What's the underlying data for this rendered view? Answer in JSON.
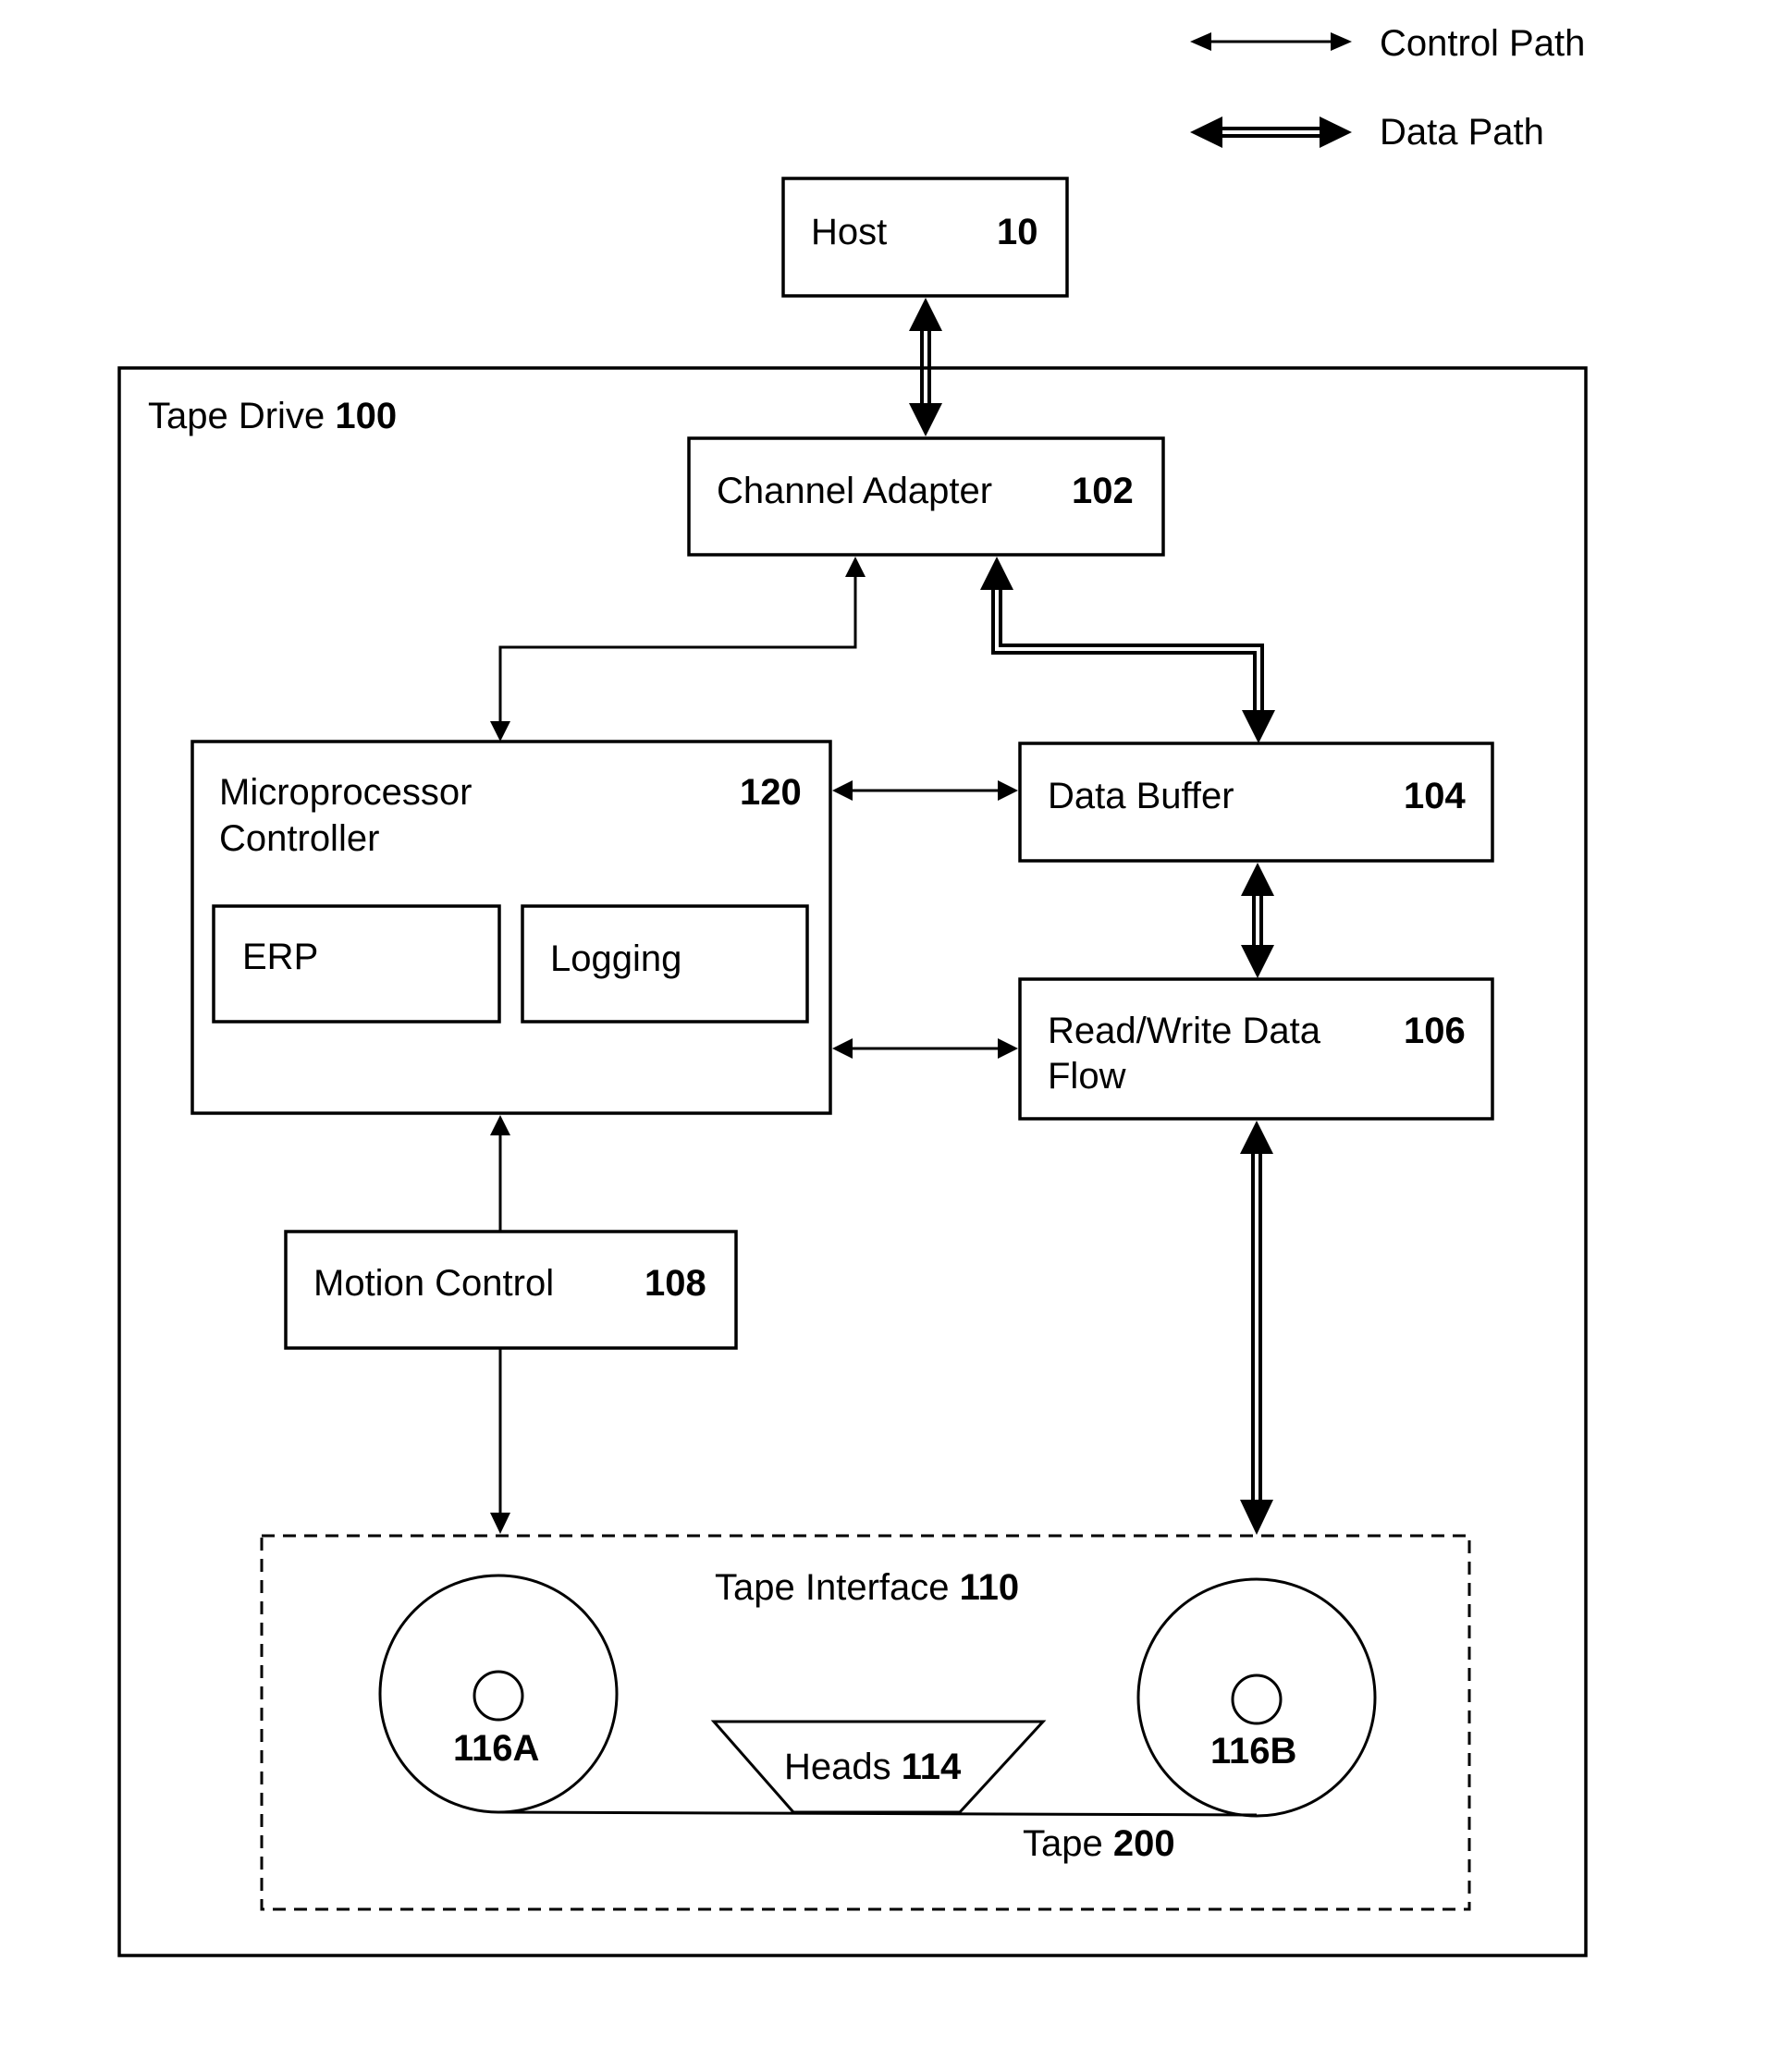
{
  "legend": {
    "control_path": "Control Path",
    "data_path": "Data Path"
  },
  "host": {
    "label": "Host",
    "number": "10"
  },
  "tape_drive": {
    "label": "Tape Drive",
    "number": "100"
  },
  "channel_adapter": {
    "label": "Channel Adapter",
    "number": "102"
  },
  "microprocessor": {
    "label_line1": "Microprocessor",
    "label_line2": "Controller",
    "number": "120"
  },
  "erp": {
    "label": "ERP"
  },
  "logging": {
    "label": "Logging"
  },
  "data_buffer": {
    "label": "Data Buffer",
    "number": "104"
  },
  "read_write": {
    "label_line1": "Read/Write Data",
    "label_line2": "Flow",
    "number": "106"
  },
  "motion_control": {
    "label": "Motion Control",
    "number": "108"
  },
  "tape_interface": {
    "label": "Tape Interface",
    "number": "110"
  },
  "reel_a": {
    "label": "116A"
  },
  "reel_b": {
    "label": "116B"
  },
  "heads": {
    "label": "Heads",
    "number": "114"
  },
  "tape": {
    "label": "Tape",
    "number": "200"
  }
}
